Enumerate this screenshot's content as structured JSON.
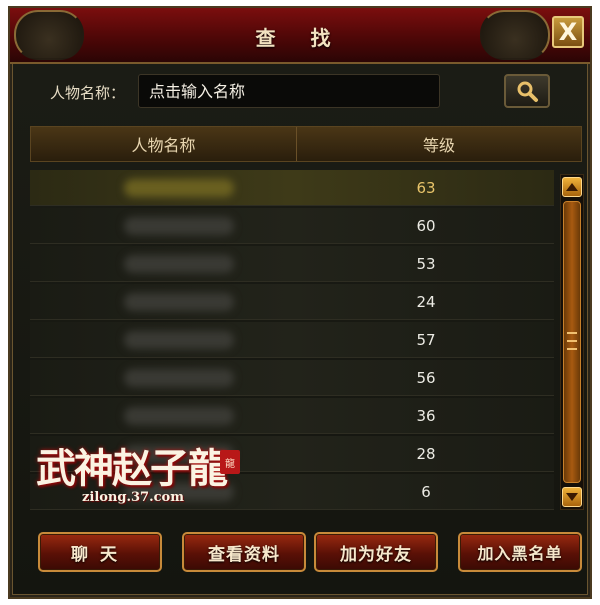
{
  "window": {
    "title": "查 找",
    "close_glyph": "X"
  },
  "search": {
    "label": "人物名称：",
    "placeholder": "点击输入名称",
    "button_icon": "search-icon"
  },
  "table": {
    "columns": [
      "人物名称",
      "等级"
    ],
    "rows": [
      {
        "level": "63",
        "selected": true
      },
      {
        "level": "60",
        "selected": false
      },
      {
        "level": "53",
        "selected": false
      },
      {
        "level": "24",
        "selected": false
      },
      {
        "level": "57",
        "selected": false
      },
      {
        "level": "56",
        "selected": false
      },
      {
        "level": "36",
        "selected": false
      },
      {
        "level": "28",
        "selected": false
      },
      {
        "level": "6",
        "selected": false
      }
    ]
  },
  "scrollbar": {
    "up_icon": "arrow-up-icon",
    "down_icon": "arrow-down-icon"
  },
  "logo": {
    "text": "武神赵子龍",
    "seal": "龍",
    "url": "zilong.37.com"
  },
  "buttons": {
    "chat": "聊天",
    "view_profile": "查看资料",
    "add_friend": "加为好友",
    "add_blacklist": "加入黑名单"
  },
  "colors": {
    "title_red": "#7b0e0e",
    "gold_border": "#c88a3a",
    "selected_level": "#e8c46a",
    "scroll_orange": "#a85a10"
  }
}
